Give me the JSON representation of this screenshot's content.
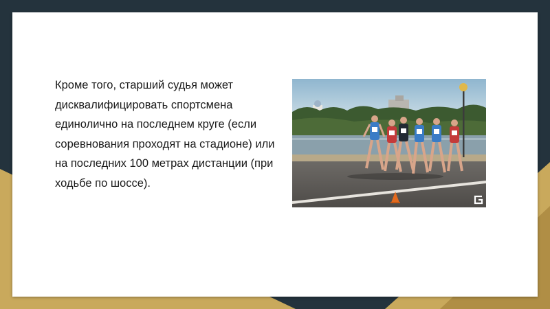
{
  "slide": {
    "body_text": "Кроме того, старший судья может дисквалифицировать спортсмена единолично на последнем круге (если соревнования проходят на стадионе) или на последних 100 метрах дистанции (при ходьбе по шоссе)."
  },
  "photo": {
    "description_icon": "race-walking-photo",
    "watermark_icon": "g-logo-icon"
  },
  "colors": {
    "background_dark": "#24333d",
    "background_gold": "#c9a95c",
    "slide": "#ffffff",
    "text": "#1a1a1a"
  }
}
